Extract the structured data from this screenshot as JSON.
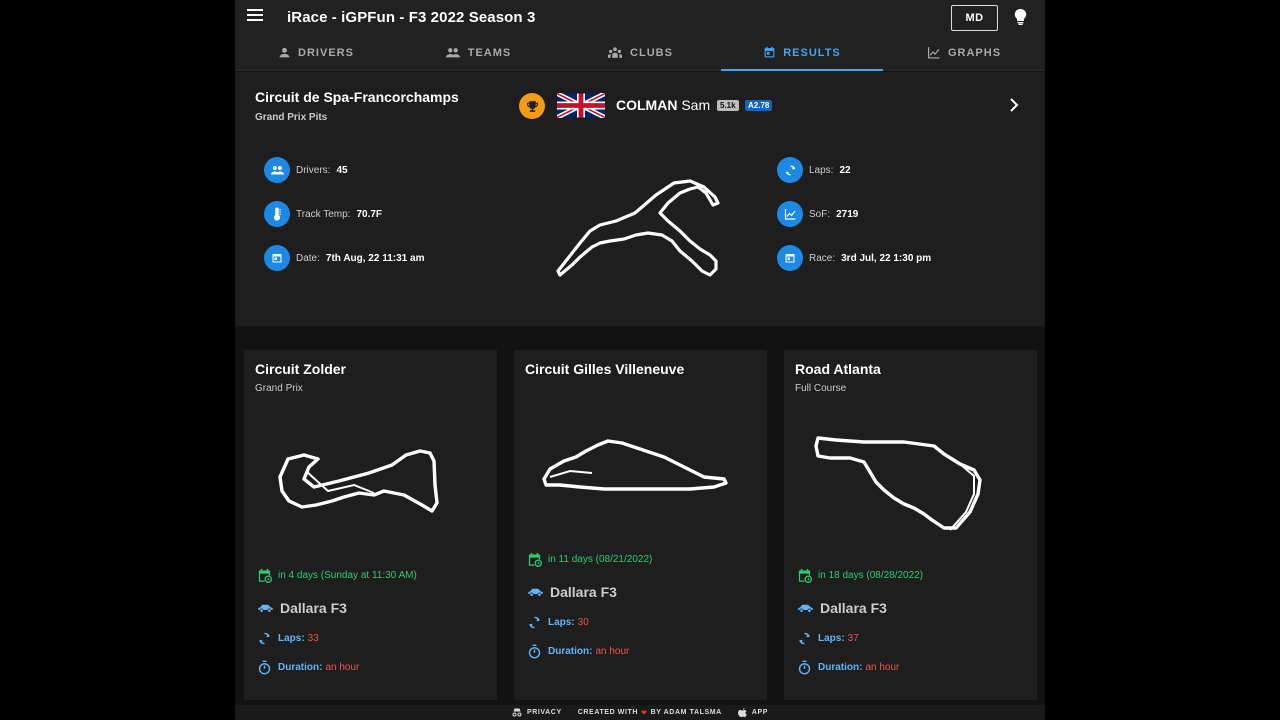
{
  "app": {
    "title": "iRace - iGPFun - F3 2022 Season 3",
    "user_initials": "MD"
  },
  "tabs": [
    {
      "label": "DRIVERS",
      "icon": "person-icon"
    },
    {
      "label": "TEAMS",
      "icon": "people-icon"
    },
    {
      "label": "CLUBS",
      "icon": "group-icon"
    },
    {
      "label": "RESULTS",
      "icon": "calendar-icon",
      "active": true
    },
    {
      "label": "GRAPHS",
      "icon": "chart-icon"
    }
  ],
  "featured": {
    "track": "Circuit de Spa-Francorchamps",
    "config": "Grand Prix Pits",
    "winner_last": "COLMAN",
    "winner_first": "Sam",
    "sr_badge": "5.1k",
    "license_badge": "A2.78",
    "stats_left": [
      {
        "label": "Drivers:",
        "value": "45",
        "icon": "people-icon"
      },
      {
        "label": "Track Temp:",
        "value": "70.7F",
        "icon": "thermometer-icon"
      },
      {
        "label": "Date:",
        "value": "7th Aug, 22 11:31 am",
        "icon": "calendar-icon"
      }
    ],
    "stats_right": [
      {
        "label": "Laps:",
        "value": "22",
        "icon": "laps-icon"
      },
      {
        "label": "SoF:",
        "value": "2719",
        "icon": "chart-icon"
      },
      {
        "label": "Race:",
        "value": "3rd Jul, 22 1:30 pm",
        "icon": "calendar-icon"
      }
    ]
  },
  "upcoming": [
    {
      "track": "Circuit Zolder",
      "config": "Grand Prix",
      "when": "in 4 days (Sunday at 11:30 AM)",
      "car": "Dallara F3",
      "laps_label": "Laps:",
      "laps": "33",
      "duration_label": "Duration:",
      "duration": "an hour"
    },
    {
      "track": "Circuit Gilles Villeneuve",
      "config": "",
      "when": "in 11 days (08/21/2022)",
      "car": "Dallara F3",
      "laps_label": "Laps:",
      "laps": "30",
      "duration_label": "Duration:",
      "duration": "an hour"
    },
    {
      "track": "Road Atlanta",
      "config": "Full Course",
      "when": "in 18 days (08/28/2022)",
      "car": "Dallara F3",
      "laps_label": "Laps:",
      "laps": "37",
      "duration_label": "Duration:",
      "duration": "an hour"
    }
  ],
  "footer": {
    "privacy": "PRIVACY",
    "created_pre": "CREATED WITH",
    "created_post": "BY ADAM TALSMA",
    "app": "APP"
  },
  "colors": {
    "accent": "#42a5f5",
    "stat_icon": "#1e88e5",
    "trophy": "#f39c12",
    "green": "#2ecc71",
    "red": "#ef5350"
  }
}
